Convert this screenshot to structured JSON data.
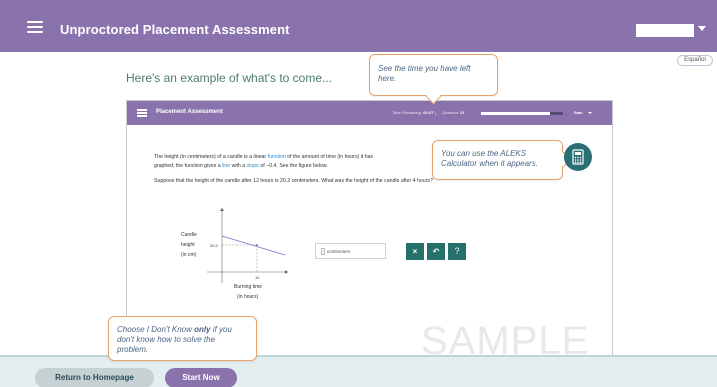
{
  "header": {
    "title": "Unproctored Placement Assessment",
    "account_name": ""
  },
  "language_button": "Español",
  "intro": "Here's an example of what's to come...",
  "callouts": {
    "time": "See the time you have left here.",
    "calculator": "You can use the ALEKS Calculator when it appears.",
    "dont_know_prefix": "Choose I Don't Know ",
    "dont_know_bold": "only",
    "dont_know_suffix": " if you don't know how to solve the problem."
  },
  "sample": {
    "title": "Placement Assessment",
    "time_label": "Time Remaining:",
    "time_value": "00:27",
    "separator": "|",
    "question_label": "Question:",
    "question_value": "21",
    "progress_fraction": 0.84,
    "user_label": "Sam",
    "question_parts": {
      "p1": "The height (in centimeters) of a candle is a linear ",
      "w1": "function",
      "p2": " of the amount of time (in hours) it has",
      "p3": "graphed, the function gives a ",
      "w2": "line",
      "p4": " with a ",
      "w3": "slope",
      "p5": " of −0.4. See the figure below."
    },
    "question2": "Suppose that the height of the candle after 12 hours is 20.2 centimeters. What was the height of the candle after 4 hours?",
    "graph": {
      "ylabel_1": "Candle",
      "ylabel_2": "height",
      "ylabel_3": "(in cm)",
      "ytick": "20.2",
      "xtick": "12",
      "xlabel_1": "Burning time",
      "xlabel_2": "(in hours)"
    },
    "answer_unit": "centimeters",
    "buttons": {
      "clear": "×",
      "undo": "↶",
      "help": "?"
    },
    "watermark": "SAMPLE"
  },
  "footer": {
    "home": "Return to Homepage",
    "start": "Start Now"
  },
  "colors": {
    "brand": "#8a73ad",
    "teal": "#26716b",
    "callout_border": "#e8a26b"
  }
}
